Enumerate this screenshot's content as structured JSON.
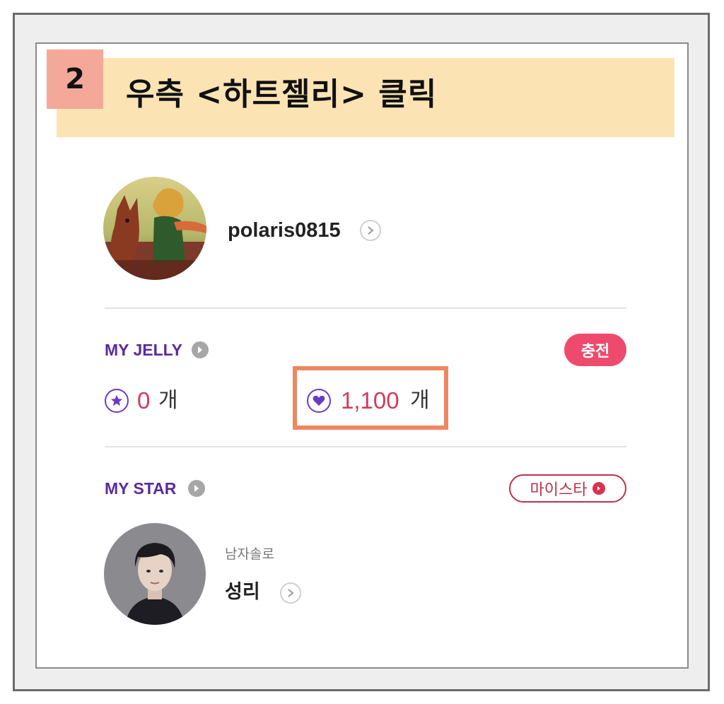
{
  "step": {
    "number": "2",
    "title": "우측 <하트젤리> 클릭"
  },
  "profile": {
    "username": "polaris0815"
  },
  "my_jelly": {
    "label": "MY JELLY",
    "charge_label": "충전",
    "star_jelly": {
      "count": "0",
      "unit": "개",
      "icon": "star-icon"
    },
    "heart_jelly": {
      "count": "1,100",
      "unit": "개",
      "icon": "heart-icon"
    }
  },
  "my_star": {
    "label": "MY STAR",
    "mystar_label": "마이스타",
    "star": {
      "category": "남자솔로",
      "name": "성리"
    }
  },
  "colors": {
    "banner": "#fbe3b4",
    "badge": "#f3a89a",
    "accent_purple": "#5b2a9c",
    "count_red": "#d33a5a",
    "charge_pink": "#ee4a6e",
    "highlight": "#ef8660"
  }
}
